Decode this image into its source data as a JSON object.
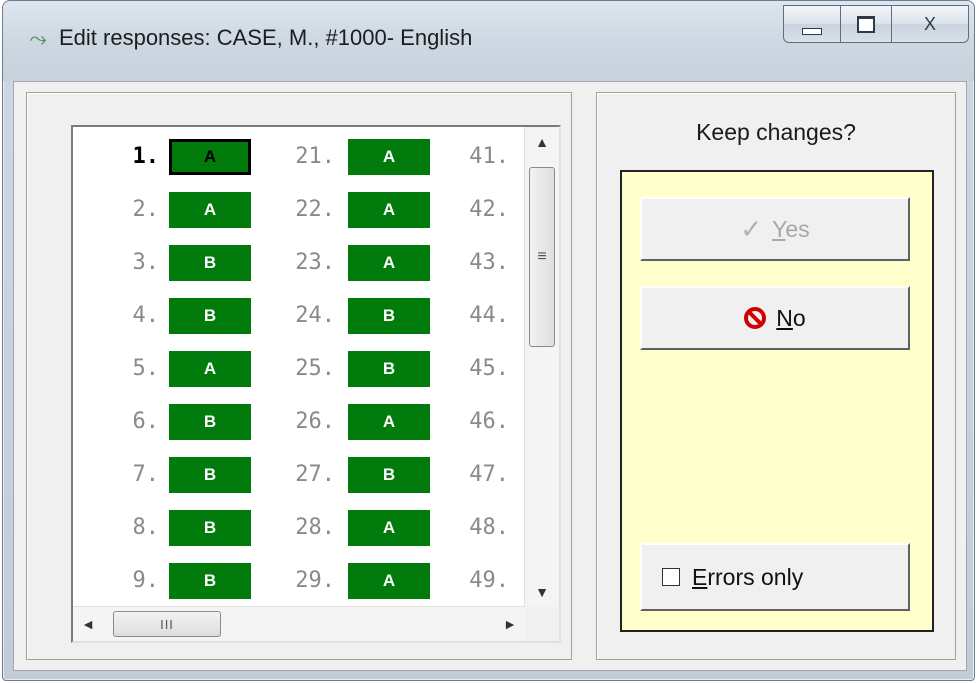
{
  "window": {
    "title": "Edit responses: CASE, M., #1000- English",
    "controls": {
      "minimize": "minimize",
      "maximize": "maximize",
      "close": "X"
    }
  },
  "responses": {
    "selected": 1,
    "columns": [
      [
        {
          "num": "1.",
          "ans": "A"
        },
        {
          "num": "2.",
          "ans": "A"
        },
        {
          "num": "3.",
          "ans": "B"
        },
        {
          "num": "4.",
          "ans": "B"
        },
        {
          "num": "5.",
          "ans": "A"
        },
        {
          "num": "6.",
          "ans": "B"
        },
        {
          "num": "7.",
          "ans": "B"
        },
        {
          "num": "8.",
          "ans": "B"
        },
        {
          "num": "9.",
          "ans": "B"
        }
      ],
      [
        {
          "num": "21.",
          "ans": "A"
        },
        {
          "num": "22.",
          "ans": "A"
        },
        {
          "num": "23.",
          "ans": "A"
        },
        {
          "num": "24.",
          "ans": "B"
        },
        {
          "num": "25.",
          "ans": "B"
        },
        {
          "num": "26.",
          "ans": "A"
        },
        {
          "num": "27.",
          "ans": "B"
        },
        {
          "num": "28.",
          "ans": "A"
        },
        {
          "num": "29.",
          "ans": "A"
        }
      ],
      [
        {
          "num": "41."
        },
        {
          "num": "42."
        },
        {
          "num": "43."
        },
        {
          "num": "44."
        },
        {
          "num": "45."
        },
        {
          "num": "46."
        },
        {
          "num": "47."
        },
        {
          "num": "48."
        },
        {
          "num": "49."
        }
      ]
    ]
  },
  "scrollbars": {
    "v_up": "▲",
    "v_down": "▼",
    "v_grip": "≡",
    "h_left": "◄",
    "h_right": "►",
    "h_grip": "III"
  },
  "confirm": {
    "question": "Keep changes?",
    "yes": {
      "label_first": "Y",
      "label_rest": "es",
      "enabled": false
    },
    "no": {
      "label_first": "N",
      "label_rest": "o",
      "enabled": true
    },
    "errors_only": {
      "label_first": "E",
      "label_rest": "rrors only",
      "checked": false
    }
  },
  "colors": {
    "answer_bg": "#007b0c",
    "panel_bg": "#ffffcc",
    "no_icon": "#d10000"
  }
}
